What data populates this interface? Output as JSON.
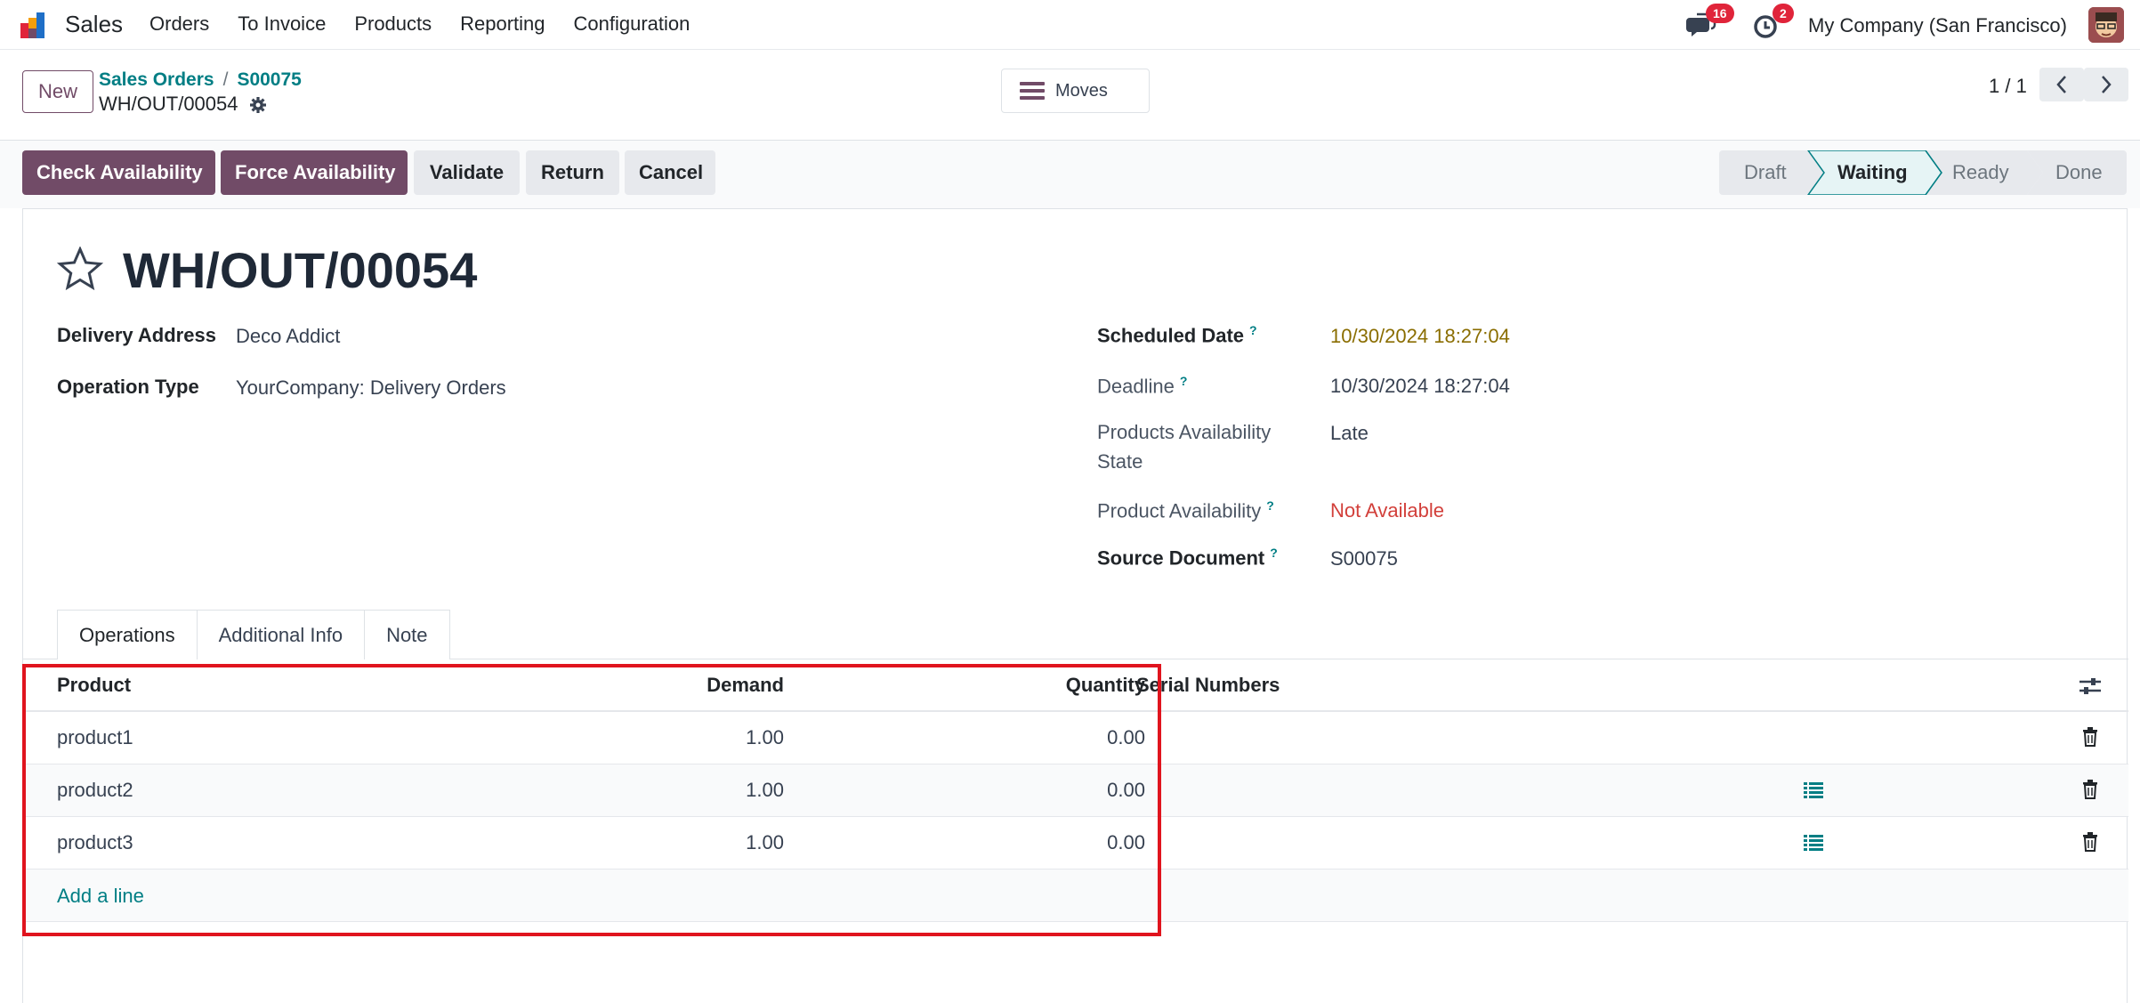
{
  "navbar": {
    "app_name": "Sales",
    "menu": [
      "Orders",
      "To Invoice",
      "Products",
      "Reporting",
      "Configuration"
    ],
    "messages_badge": "16",
    "activities_badge": "2",
    "company": "My Company (San Francisco)"
  },
  "control": {
    "new_label": "New",
    "breadcrumb": [
      "Sales Orders",
      "S00075"
    ],
    "record_name": "WH/OUT/00054",
    "moves_label": "Moves",
    "pager": "1 / 1"
  },
  "actions": {
    "check_availability": "Check Availability",
    "force_availability": "Force Availability",
    "validate": "Validate",
    "return": "Return",
    "cancel": "Cancel"
  },
  "statusbar": {
    "stages": [
      "Draft",
      "Waiting",
      "Ready",
      "Done"
    ],
    "active": "Waiting"
  },
  "form": {
    "title": "WH/OUT/00054",
    "delivery_address_label": "Delivery Address",
    "delivery_address": "Deco Addict",
    "operation_type_label": "Operation Type",
    "operation_type": "YourCompany: Delivery Orders",
    "scheduled_date_label": "Scheduled Date",
    "scheduled_date": "10/30/2024 18:27:04",
    "deadline_label": "Deadline",
    "deadline": "10/30/2024 18:27:04",
    "availability_state_label_1": "Products Availability",
    "availability_state_label_2": "State",
    "availability_state": "Late",
    "product_availability_label": "Product Availability",
    "product_availability": "Not Available",
    "source_document_label": "Source Document",
    "source_document": "S00075",
    "help_mark": "?"
  },
  "tabs": [
    "Operations",
    "Additional Info",
    "Note"
  ],
  "table": {
    "headers": {
      "product": "Product",
      "demand": "Demand",
      "quantity": "Quantity",
      "serial": "Serial Numbers"
    },
    "rows": [
      {
        "product": "product1",
        "demand": "1.00",
        "quantity": "0.00"
      },
      {
        "product": "product2",
        "demand": "1.00",
        "quantity": "0.00"
      },
      {
        "product": "product3",
        "demand": "1.00",
        "quantity": "0.00"
      }
    ],
    "add_line": "Add a line"
  },
  "colors": {
    "primary": "#714b67",
    "link": "#017e84",
    "danger": "#d23f3a",
    "highlight": "#e0141e"
  },
  "icons": [
    "star-icon",
    "gear-icon",
    "hamburger-icon",
    "chat-icon",
    "clock-icon",
    "chevron-left-icon",
    "chevron-right-icon",
    "settings-sliders-icon",
    "trash-icon",
    "list-icon"
  ]
}
